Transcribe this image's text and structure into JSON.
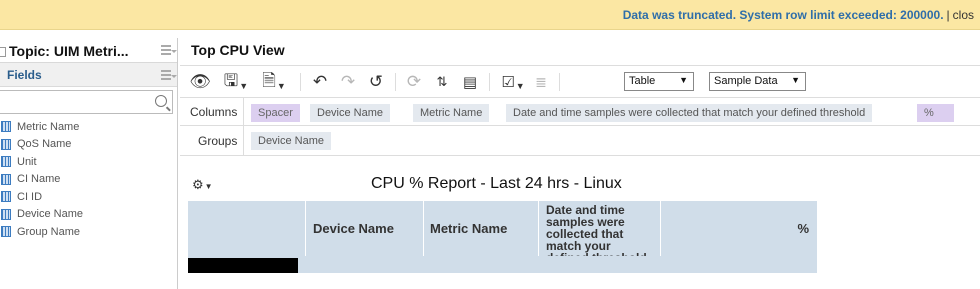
{
  "banner": {
    "message": "Data was truncated. System row limit exceeded: 200000.",
    "separator": "|",
    "close_label": "clos"
  },
  "left_panel": {
    "topic_title": "Topic: UIM Metri...",
    "fields_label": "Fields",
    "search": {
      "placeholder": ""
    },
    "field_items": [
      "Metric Name",
      "QoS Name",
      "Unit",
      "CI Name",
      "CI ID",
      "Device Name",
      "Group Name"
    ]
  },
  "main": {
    "view_title": "Top CPU View",
    "toolbar": {
      "view_select": "Table",
      "data_select": "Sample Data"
    },
    "columns_label": "Columns",
    "groups_label": "Groups",
    "column_chips": [
      "Spacer",
      "Device Name",
      "Metric Name",
      "Date and time samples were collected that match your defined threshold",
      "%"
    ],
    "group_chips": [
      "Device Name"
    ],
    "report": {
      "title": "CPU % Report - Last 24 hrs - Linux",
      "headers": [
        "",
        "Device Name",
        "Metric Name",
        "Date and time samples were collected that match your defined threshold",
        "%"
      ]
    }
  },
  "colors": {
    "banner_bg": "#fbe7a3",
    "banner_text": "#2f6ea9",
    "table_bg": "#d0dde9",
    "chip_bg": "#e4e9ef",
    "chip_purple": "#dccff0"
  }
}
